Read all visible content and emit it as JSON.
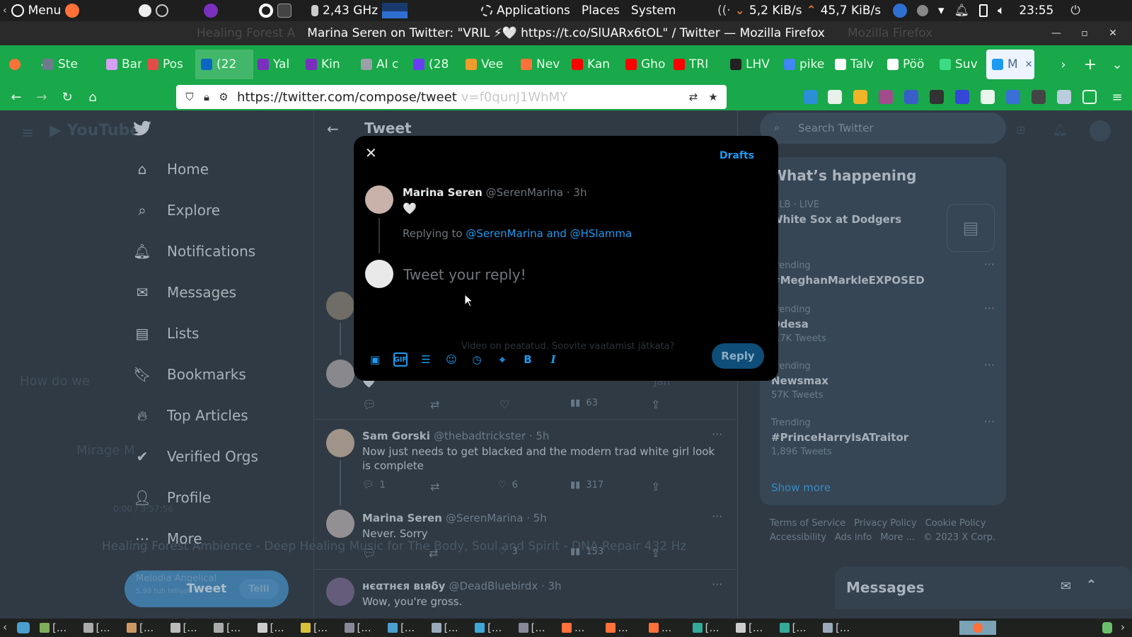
{
  "system": {
    "menu_label": "Menu",
    "cpu": "2,43 GHz",
    "applications": "Applications",
    "places": "Places",
    "system": "System",
    "net_down": "5,2 KiB/s",
    "net_up": "45,7 KiB/s",
    "clock": "23:55"
  },
  "window": {
    "title": "Marina Seren on Twitter: \"VRIL ⚡🤍 https://t.co/SlUARx6tOL\" / Twitter — Mozilla Firefox",
    "ghost_left": "Healing Forest A",
    "ghost_right": "Mozilla Firefox"
  },
  "tabs": [
    {
      "label": "Ste",
      "color": "#6c7a89"
    },
    {
      "label": "Bar",
      "color": "#d4a1f0"
    },
    {
      "label": "Pos",
      "color": "#e34b4b"
    },
    {
      "label": "(22",
      "color": "#0a66c2"
    },
    {
      "label": "Yal",
      "color": "#7b2fbe"
    },
    {
      "label": "Kin",
      "color": "#7b2fbe"
    },
    {
      "label": "AI c",
      "color": "#9aa0a6"
    },
    {
      "label": "(28",
      "color": "#6a3df5"
    },
    {
      "label": "Vee",
      "color": "#f29b2d"
    },
    {
      "label": "Nev",
      "color": "#ff7139"
    },
    {
      "label": "Kan",
      "color": "#ff0000"
    },
    {
      "label": "Gho",
      "color": "#ff0000"
    },
    {
      "label": "TRI",
      "color": "#ff0000"
    },
    {
      "label": "LHV",
      "color": "#222222"
    },
    {
      "label": "pike",
      "color": "#4285f4"
    },
    {
      "label": "Talv",
      "color": "#ffffff"
    },
    {
      "label": "Pöö",
      "color": "#ffffff"
    },
    {
      "label": "Suv",
      "color": "#3ddc84"
    },
    {
      "label": "M",
      "color": "#1d9bf0"
    }
  ],
  "nav": {
    "url": "https://twitter.com/compose/tweet",
    "url_ghost": "v=f0qunJ1WhMY"
  },
  "sidebar": {
    "items": [
      {
        "label": "Home"
      },
      {
        "label": "Explore"
      },
      {
        "label": "Notifications"
      },
      {
        "label": "Messages"
      },
      {
        "label": "Lists"
      },
      {
        "label": "Bookmarks"
      },
      {
        "label": "Top Articles"
      },
      {
        "label": "Verified Orgs"
      },
      {
        "label": "Profile"
      },
      {
        "label": "More"
      }
    ],
    "tweet_button": "Tweet"
  },
  "timeline": {
    "header": "Tweet",
    "tweets": [
      {
        "text": "🤍",
        "views": "63",
        "time": "Jah"
      },
      {
        "name": "Sam Gorski",
        "handle": "@thebadtrickster · 5h",
        "text": "Now just needs to get blacked and the modern trad white girl look is complete",
        "replies": "1",
        "likes": "6",
        "views": "317"
      },
      {
        "name": "Marina Seren",
        "handle": "@SerenMarina · 5h",
        "text": "Never. Sorry",
        "likes": "3",
        "views": "153"
      },
      {
        "name": "нєαтнєя вιяδу",
        "handle": "@DeadBluebirdx · 3h",
        "text": "Wow, you're gross."
      }
    ]
  },
  "right": {
    "search_placeholder": "Search Twitter",
    "happening_title": "What’s happening",
    "trends": [
      {
        "cat": "MLB · LIVE",
        "title": "White Sox at Dodgers",
        "count": ""
      },
      {
        "cat": "Trending",
        "title": "#MeghanMarkleEXPOSED",
        "count": ""
      },
      {
        "cat": "Trending",
        "title": "Odesa",
        "count": "9.7K Tweets"
      },
      {
        "cat": "Trending",
        "title": "Newsmax",
        "count": "57K Tweets"
      },
      {
        "cat": "Trending",
        "title": "#PrinceHarryIsATraitor",
        "count": "1,896 Tweets"
      }
    ],
    "show_more": "Show more",
    "footer": [
      "Terms of Service",
      "Privacy Policy",
      "Cookie Policy",
      "Accessibility",
      "Ads info",
      "More ...",
      "© 2023 X Corp."
    ],
    "messages": "Messages"
  },
  "modal": {
    "drafts": "Drafts",
    "author_name": "Marina Seren",
    "author_meta": "@SerenMarina · 3h",
    "author_text": "🤍",
    "replying_prefix": "Replying to",
    "replying_to": "@SerenMarina and @HSlamma",
    "placeholder": "Tweet your reply!",
    "reply_button": "Reply",
    "ghost_text": "Video on peatatud. Soovite vaatamist jätkata?"
  },
  "background_ghosts": {
    "youtube_title": "Healing Forest Ambience - Deep Healing Music for The Body, Soul and Spirit - DNA Repair 432 Hz",
    "time": "0:00 / 3:57:56",
    "question": "How do we",
    "mirage": "Mirage M",
    "channel": "Melodia Angelical",
    "subs": "5.99 tuh tellijat",
    "subscribe": "Telli"
  },
  "taskbar": {
    "items": [
      "[...",
      "[...",
      "[...",
      "[...",
      "[...",
      "[...",
      "[...",
      "[...",
      "[...",
      "[...",
      "[...",
      "[...",
      "...",
      "...",
      "...",
      "[...",
      "[...",
      "[...",
      "[..."
    ]
  }
}
